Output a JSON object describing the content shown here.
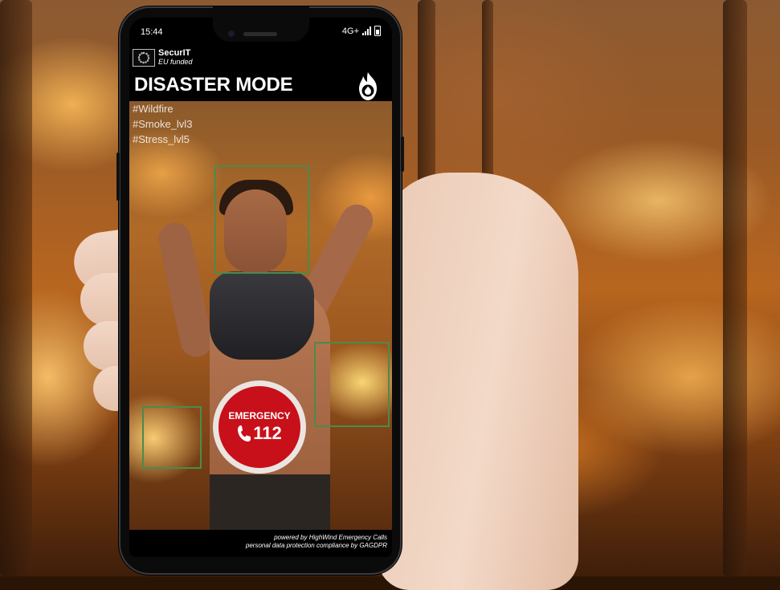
{
  "status_bar": {
    "time": "15:44",
    "network": "4G+"
  },
  "brand": {
    "name": "SecurIT",
    "subtitle": "EU funded"
  },
  "header": {
    "title": "DISASTER MODE"
  },
  "tags": [
    "#Wildfire",
    "#Smoke_lvl3",
    "#Stress_lvl5"
  ],
  "emergency": {
    "label": "EMERGENCY",
    "number": "112"
  },
  "footer": {
    "line1": "powered by HighWind Emergency Calls",
    "line2": "personal data protection compliance by GAGDPR"
  },
  "colors": {
    "emergency_red": "#c8101a",
    "detection_box": "#4c8a4c"
  }
}
